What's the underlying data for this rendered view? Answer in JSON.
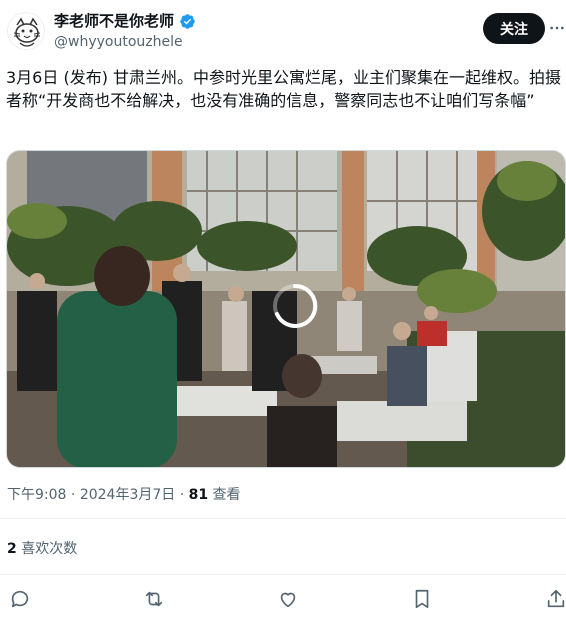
{
  "author": {
    "display_name": "李老师不是你老师",
    "handle": "@whyyoutouzhele",
    "verified": true
  },
  "header": {
    "follow_label": "关注",
    "more_icon": "more-horizontal-icon"
  },
  "tweet": {
    "text": "3月6日 (发布) 甘肃兰州。中参时光里公寓烂尾，业主们聚集在一起维权。拍摄者称“开发商也不给解决，也没有准确的信息，警察同志也不让咱们写条幅”"
  },
  "media": {
    "type": "video",
    "state": "loading"
  },
  "meta": {
    "time": "下午9:08",
    "separator": " · ",
    "date": "2024年3月7日",
    "views_count": "81",
    "views_label": " 查看"
  },
  "engagement": {
    "likes_count": "2",
    "likes_label": " 喜欢次数"
  },
  "actions": {
    "reply_icon": "reply-icon",
    "retweet_icon": "retweet-icon",
    "like_icon": "heart-icon",
    "bookmark_icon": "bookmark-icon",
    "share_icon": "share-icon"
  },
  "colors": {
    "text_primary": "#0f1419",
    "text_secondary": "#536471",
    "verified_blue": "#1d9bf0",
    "divider": "#eff3f4"
  }
}
